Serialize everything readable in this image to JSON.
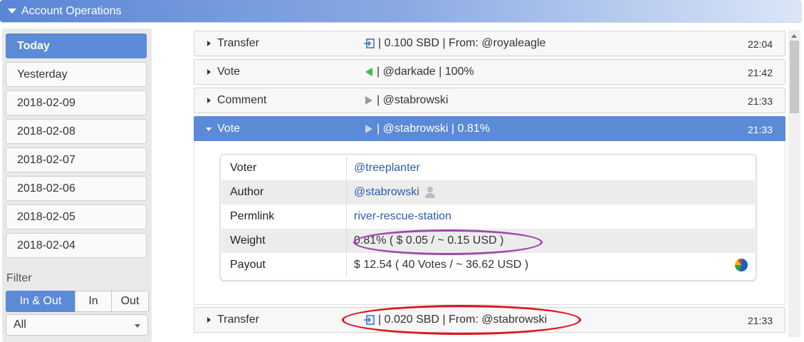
{
  "header": {
    "title": "Account Operations"
  },
  "sidebar": {
    "days": [
      {
        "label": "Today",
        "active": true
      },
      {
        "label": "Yesterday",
        "active": false
      },
      {
        "label": "2018-02-09",
        "active": false
      },
      {
        "label": "2018-02-08",
        "active": false
      },
      {
        "label": "2018-02-07",
        "active": false
      },
      {
        "label": "2018-02-06",
        "active": false
      },
      {
        "label": "2018-02-05",
        "active": false
      },
      {
        "label": "2018-02-04",
        "active": false
      }
    ],
    "filter_label": "Filter",
    "filter_options": [
      "In & Out",
      "In",
      "Out"
    ],
    "filter_selected": "In & Out",
    "type_select": "All"
  },
  "operations": [
    {
      "type": "Transfer",
      "icon": "incoming-transfer-icon",
      "detail": "| 0.100 SBD | From: @royaleagle",
      "time": "22:04"
    },
    {
      "type": "Vote",
      "icon": "green-vote-icon",
      "detail": "| @darkade | 100%",
      "time": "21:42"
    },
    {
      "type": "Comment",
      "icon": "gray-play-icon",
      "detail": "| @stabrowski",
      "time": "21:33"
    },
    {
      "type": "Vote",
      "icon": "gray-play-icon",
      "detail": "| @stabrowski | 0.81%",
      "time": "21:33",
      "expanded": true
    },
    {
      "type": "Transfer",
      "icon": "incoming-transfer-icon",
      "detail": "| 0.020 SBD | From: @stabrowski",
      "time": "21:33"
    }
  ],
  "vote_details": {
    "voter_label": "Voter",
    "voter": "@treeplanter",
    "author_label": "Author",
    "author": "@stabrowski",
    "permlink_label": "Permlink",
    "permlink": "river-rescue-station",
    "weight_label": "Weight",
    "weight": "0.81% ( $ 0.05 / ~ 0.15 USD )",
    "payout_label": "Payout",
    "payout": "$ 12.54 ( 40 Votes / ~ 36.62 USD )"
  },
  "colors": {
    "accent": "#5b8ad6",
    "link": "#2a5db0",
    "annotation_purple": "#9b4aa8",
    "annotation_red": "#e0141e"
  }
}
